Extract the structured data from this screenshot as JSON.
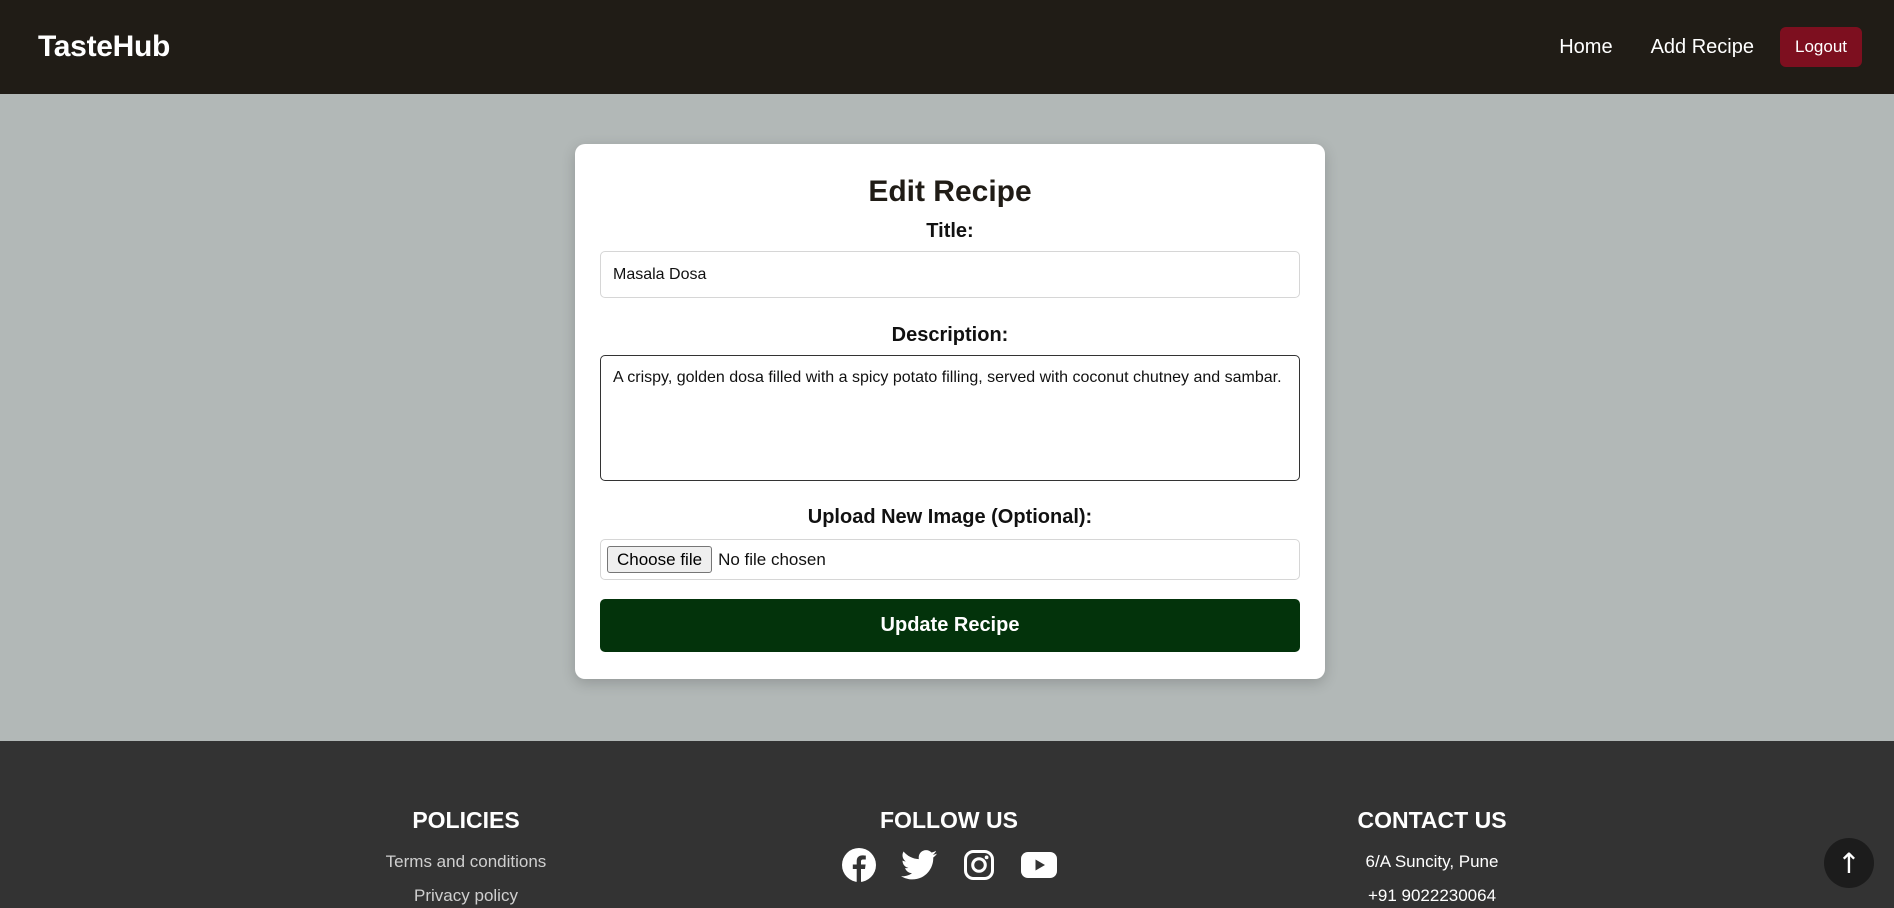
{
  "navbar": {
    "brand": "TasteHub",
    "links": [
      "Home",
      "Add Recipe"
    ],
    "logout_label": "Logout"
  },
  "form": {
    "heading": "Edit Recipe",
    "title_label": "Title:",
    "title_value": "Masala Dosa",
    "description_label": "Description:",
    "description_value": "A crispy, golden dosa filled with a spicy potato filling, served with coconut chutney and sambar.",
    "upload_label": "Upload New Image (Optional):",
    "choose_file_label": "Choose file",
    "file_status": "No file chosen",
    "submit_label": "Update Recipe"
  },
  "footer": {
    "policies": {
      "heading": "POLICIES",
      "links": [
        "Terms and conditions",
        "Privacy policy"
      ]
    },
    "follow": {
      "heading": "FOLLOW US",
      "icons": [
        "facebook-icon",
        "twitter-icon",
        "instagram-icon",
        "youtube-icon"
      ]
    },
    "contact": {
      "heading": "CONTACT US",
      "address": "6/A Suncity, Pune",
      "phone": "+91 9022230064"
    }
  },
  "scroll_top": {
    "glyph": "↑"
  },
  "colors": {
    "navbar_bg": "#201c16",
    "page_bg": "#b2b8b7",
    "logout_bg": "#7d0f1f",
    "submit_bg": "#03330b",
    "footer_bg": "#333333"
  }
}
